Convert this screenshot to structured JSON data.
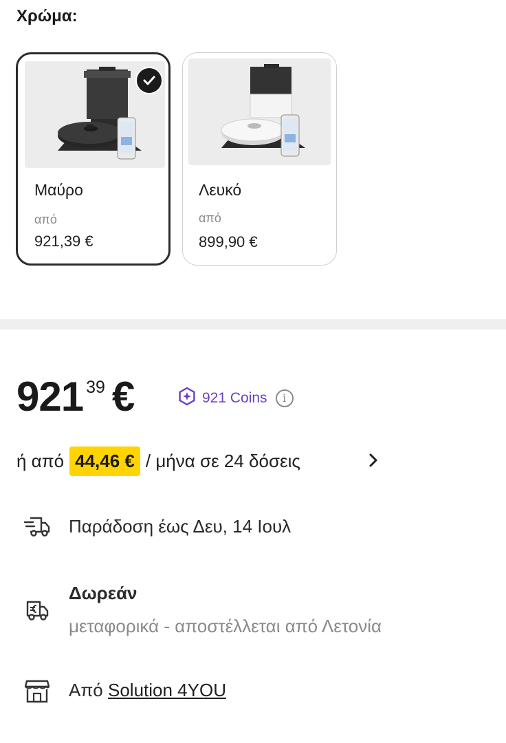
{
  "color_section": {
    "heading": "Χρώμα:",
    "variants": [
      {
        "name": "Μαύρο",
        "from_label": "από",
        "price": "921,39 €",
        "selected": true,
        "image_icon": "robot-vacuum-black-icon"
      },
      {
        "name": "Λευκό",
        "from_label": "από",
        "price": "899,90 €",
        "selected": false,
        "image_icon": "robot-vacuum-white-icon"
      }
    ]
  },
  "price": {
    "integer": "921",
    "decimal": "39",
    "currency": "€",
    "coins_text": "921 Coins",
    "coins_icon": "coin-badge-icon",
    "info_icon_label": "i"
  },
  "installment": {
    "prefix": "ή από",
    "amount": "44,46 €",
    "suffix": "/ μήνα σε 24 δόσεις"
  },
  "delivery": {
    "text": "Παράδοση έως Δευ, 14 Ιουλ",
    "icon": "fast-delivery-truck-icon"
  },
  "shipping": {
    "title": "Δωρεάν",
    "subtitle": "μεταφορικά - αποστέλλεται από Λετονία",
    "icon": "euro-truck-icon"
  },
  "seller": {
    "prefix": "Από",
    "name": "Solution 4YOU",
    "icon": "storefront-icon"
  },
  "colors": {
    "coins_purple": "#6a3fc7",
    "highlight_yellow": "#ffd400"
  }
}
